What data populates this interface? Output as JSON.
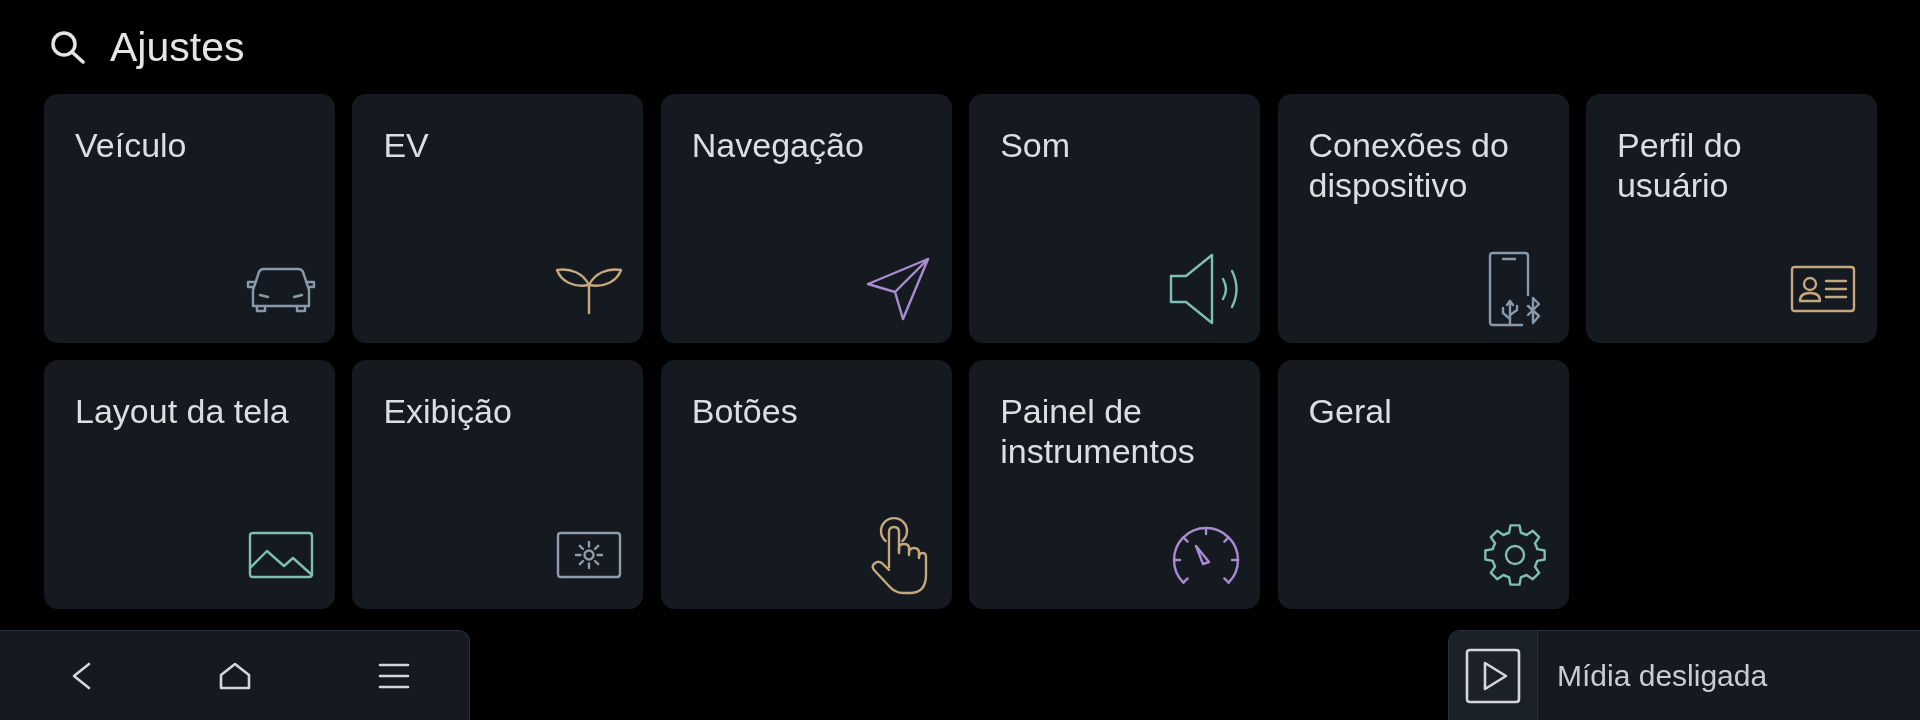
{
  "header": {
    "title": "Ajustes"
  },
  "tiles": [
    {
      "label": "Veículo",
      "kind": "vehicle"
    },
    {
      "label": "EV",
      "kind": "ev"
    },
    {
      "label": "Navegação",
      "kind": "navigation"
    },
    {
      "label": "Som",
      "kind": "sound"
    },
    {
      "label": "Conexões do dispositivo",
      "kind": "devices"
    },
    {
      "label": "Perfil do usuário",
      "kind": "profile"
    },
    {
      "label": "Layout da tela",
      "kind": "layout"
    },
    {
      "label": "Exibição",
      "kind": "display"
    },
    {
      "label": "Botões",
      "kind": "buttons"
    },
    {
      "label": "Painel de instrumentos",
      "kind": "cluster"
    },
    {
      "label": "Geral",
      "kind": "general"
    }
  ],
  "media_bar": {
    "status": "Mídia desligada"
  }
}
